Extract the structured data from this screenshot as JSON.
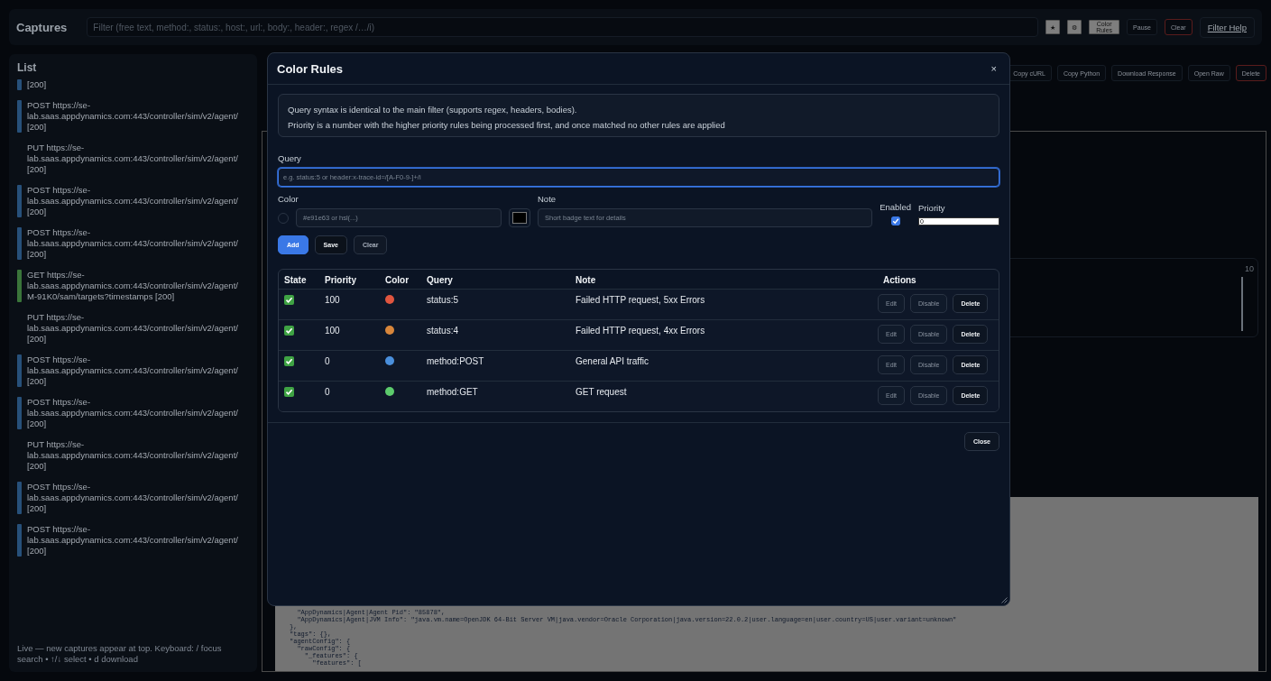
{
  "header": {
    "title": "Captures",
    "filter": {
      "placeholder": "Filter (free text, method:, status:, host:, url:, body:, header:, regex /…/i)"
    },
    "buttons": [
      {
        "label": "★",
        "kind": "light"
      },
      {
        "label": "⚙",
        "kind": "light"
      },
      {
        "label": "Color Rules",
        "kind": "light"
      },
      {
        "label": "Pause",
        "kind": "dark"
      },
      {
        "label": "Clear",
        "kind": "danger"
      }
    ],
    "help_link": "Filter Help"
  },
  "list": {
    "title": "List",
    "items": [
      {
        "text": "[200]",
        "color": "#27507a"
      },
      {
        "text": "POST https://se-\nlab.saas.appdynamics.com:443/controller/sim/v2/agent/\n[200]",
        "color": "#27507a"
      },
      {
        "text": "PUT https://se-\nlab.saas.appdynamics.com:443/controller/sim/v2/agent/\n[200]"
      },
      {
        "text": "POST https://se-\nlab.saas.appdynamics.com:443/controller/sim/v2/agent/\n[200]",
        "color": "#27507a"
      },
      {
        "text": "POST https://se-\nlab.saas.appdynamics.com:443/controller/sim/v2/agent/\n[200]",
        "color": "#27507a"
      },
      {
        "text": "GET https://se-\nlab.saas.appdynamics.com:443/controller/sim/v2/agent/\nM-91K0/sam/targets?timestamps [200]",
        "color": "#3a753a"
      },
      {
        "text": "PUT https://se-\nlab.saas.appdynamics.com:443/controller/sim/v2/agent/\n[200]"
      },
      {
        "text": "POST https://se-\nlab.saas.appdynamics.com:443/controller/sim/v2/agent/\n[200]",
        "color": "#27507a"
      },
      {
        "text": "POST https://se-\nlab.saas.appdynamics.com:443/controller/sim/v2/agent/\n[200]",
        "color": "#27507a"
      },
      {
        "text": "PUT https://se-\nlab.saas.appdynamics.com:443/controller/sim/v2/agent/\n[200]"
      },
      {
        "text": "POST https://se-\nlab.saas.appdynamics.com:443/controller/sim/v2/agent/\n[200]",
        "color": "#27507a"
      },
      {
        "text": "POST https://se-\nlab.saas.appdynamics.com:443/controller/sim/v2/agent/\n[200]",
        "color": "#27507a"
      }
    ],
    "footer": "Live — new captures appear at top. Keyboard: / focus search • ↑/↓ select • d download"
  },
  "detail": {
    "buttons": [
      {
        "label": "Copy cURL",
        "kind": "dark"
      },
      {
        "label": "Copy Python",
        "kind": "dark"
      },
      {
        "label": "Download Response",
        "kind": "dark"
      },
      {
        "label": "Open Raw",
        "kind": "dark"
      },
      {
        "label": "Delete",
        "kind": "danger"
      }
    ],
    "chart_label": "10",
    "code_lines": [
      "  \"AppDynamics|Agent|Agent Pid\": \"85878\",",
      "  \"AppDynamics|Agent|JVM Info\": \"java.vm.name=OpenJDK 64-Bit Server VM|java.vendor=Oracle Corporation|java.version=22.0.2|user.language=en|user.country=US|user.variant=unknown\"",
      "},",
      "\"tags\": {},",
      "\"agentConfig\": {",
      "  \"rawConfig\": {",
      "    \"_features\": {",
      "      \"features\": ["
    ]
  },
  "modal": {
    "title": "Color Rules",
    "close": "×",
    "info": [
      "Query syntax is identical to the main filter (supports regex, headers, bodies).",
      "Priority is a number with the higher priority rules being processed first, and once matched no other rules are applied"
    ],
    "query": {
      "label": "Query",
      "placeholder": "e.g. status:5 or header:x-trace-id=/[A-F0-9-]+/i"
    },
    "color": {
      "label": "Color",
      "placeholder": "#e91e63 or hsl(...)"
    },
    "note": {
      "label": "Note",
      "placeholder": "Short badge text for details"
    },
    "enabled": {
      "label": "Enabled",
      "checked": true
    },
    "priority": {
      "label": "Priority",
      "value": "0"
    },
    "form_buttons": [
      {
        "label": "Add",
        "kind": "primary"
      },
      {
        "label": "Save",
        "kind": "dark"
      },
      {
        "label": "Clear",
        "kind": "muted"
      }
    ],
    "columns": [
      "State",
      "Priority",
      "Color",
      "Query",
      "Note",
      "Actions"
    ],
    "rules": [
      {
        "enabled": true,
        "priority": "100",
        "color": "#e0553f",
        "query": "status:5",
        "note": "Failed HTTP request, 5xx Errors",
        "actions": [
          "Edit",
          "Disable",
          "Delete"
        ]
      },
      {
        "enabled": true,
        "priority": "100",
        "color": "#d8863b",
        "query": "status:4",
        "note": "Failed HTTP request, 4xx Errors",
        "actions": [
          "Edit",
          "Disable",
          "Delete"
        ]
      },
      {
        "enabled": true,
        "priority": "0",
        "color": "#4a8fdc",
        "query": "method:POST",
        "note": "General API traffic",
        "actions": [
          "Edit",
          "Disable",
          "Delete"
        ]
      },
      {
        "enabled": true,
        "priority": "0",
        "color": "#5ccb6c",
        "query": "method:GET",
        "note": "GET request",
        "actions": [
          "Edit",
          "Disable",
          "Delete"
        ]
      }
    ],
    "footer_button": "Close"
  }
}
